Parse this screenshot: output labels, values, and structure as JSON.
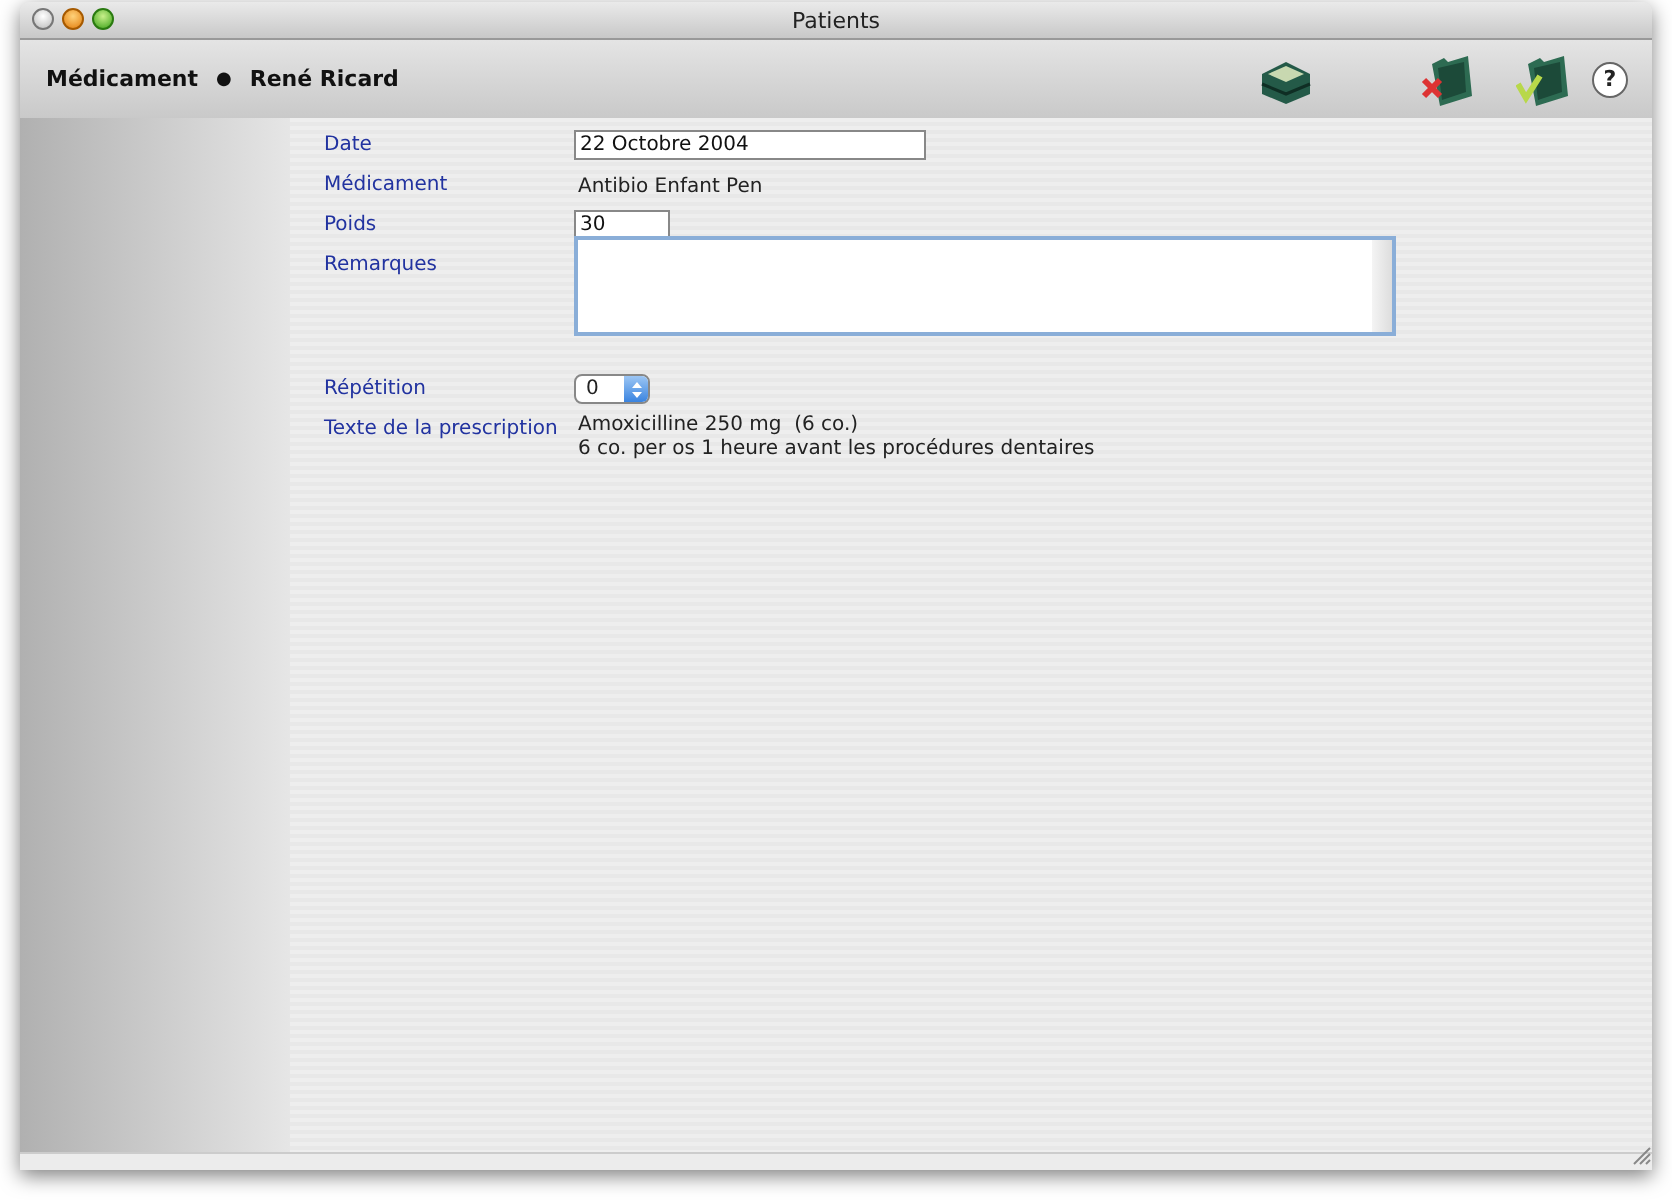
{
  "window": {
    "title": "Patients"
  },
  "header": {
    "section": "Médicament",
    "separator": "●",
    "patient": "René Ricard"
  },
  "form": [
    {
      "kind": "input",
      "label": "Date",
      "value": "22 Octobre 2004"
    },
    {
      "kind": "text",
      "label": "Médicament",
      "value": "Antibio Enfant Pen"
    },
    {
      "kind": "number",
      "label": "Poids",
      "value": "30"
    },
    {
      "kind": "textarea",
      "label": "Remarques",
      "focused": true
    },
    {
      "kind": "select",
      "label": "Répétition",
      "value": "0"
    },
    {
      "kind": "lines",
      "label": "Texte de la prescription",
      "lines": [
        "Amoxicilline 250 mg  (6 co.)",
        "6 co. per os 1 heure avant les procédures dentaires"
      ]
    }
  ],
  "help": {
    "label": "?"
  }
}
